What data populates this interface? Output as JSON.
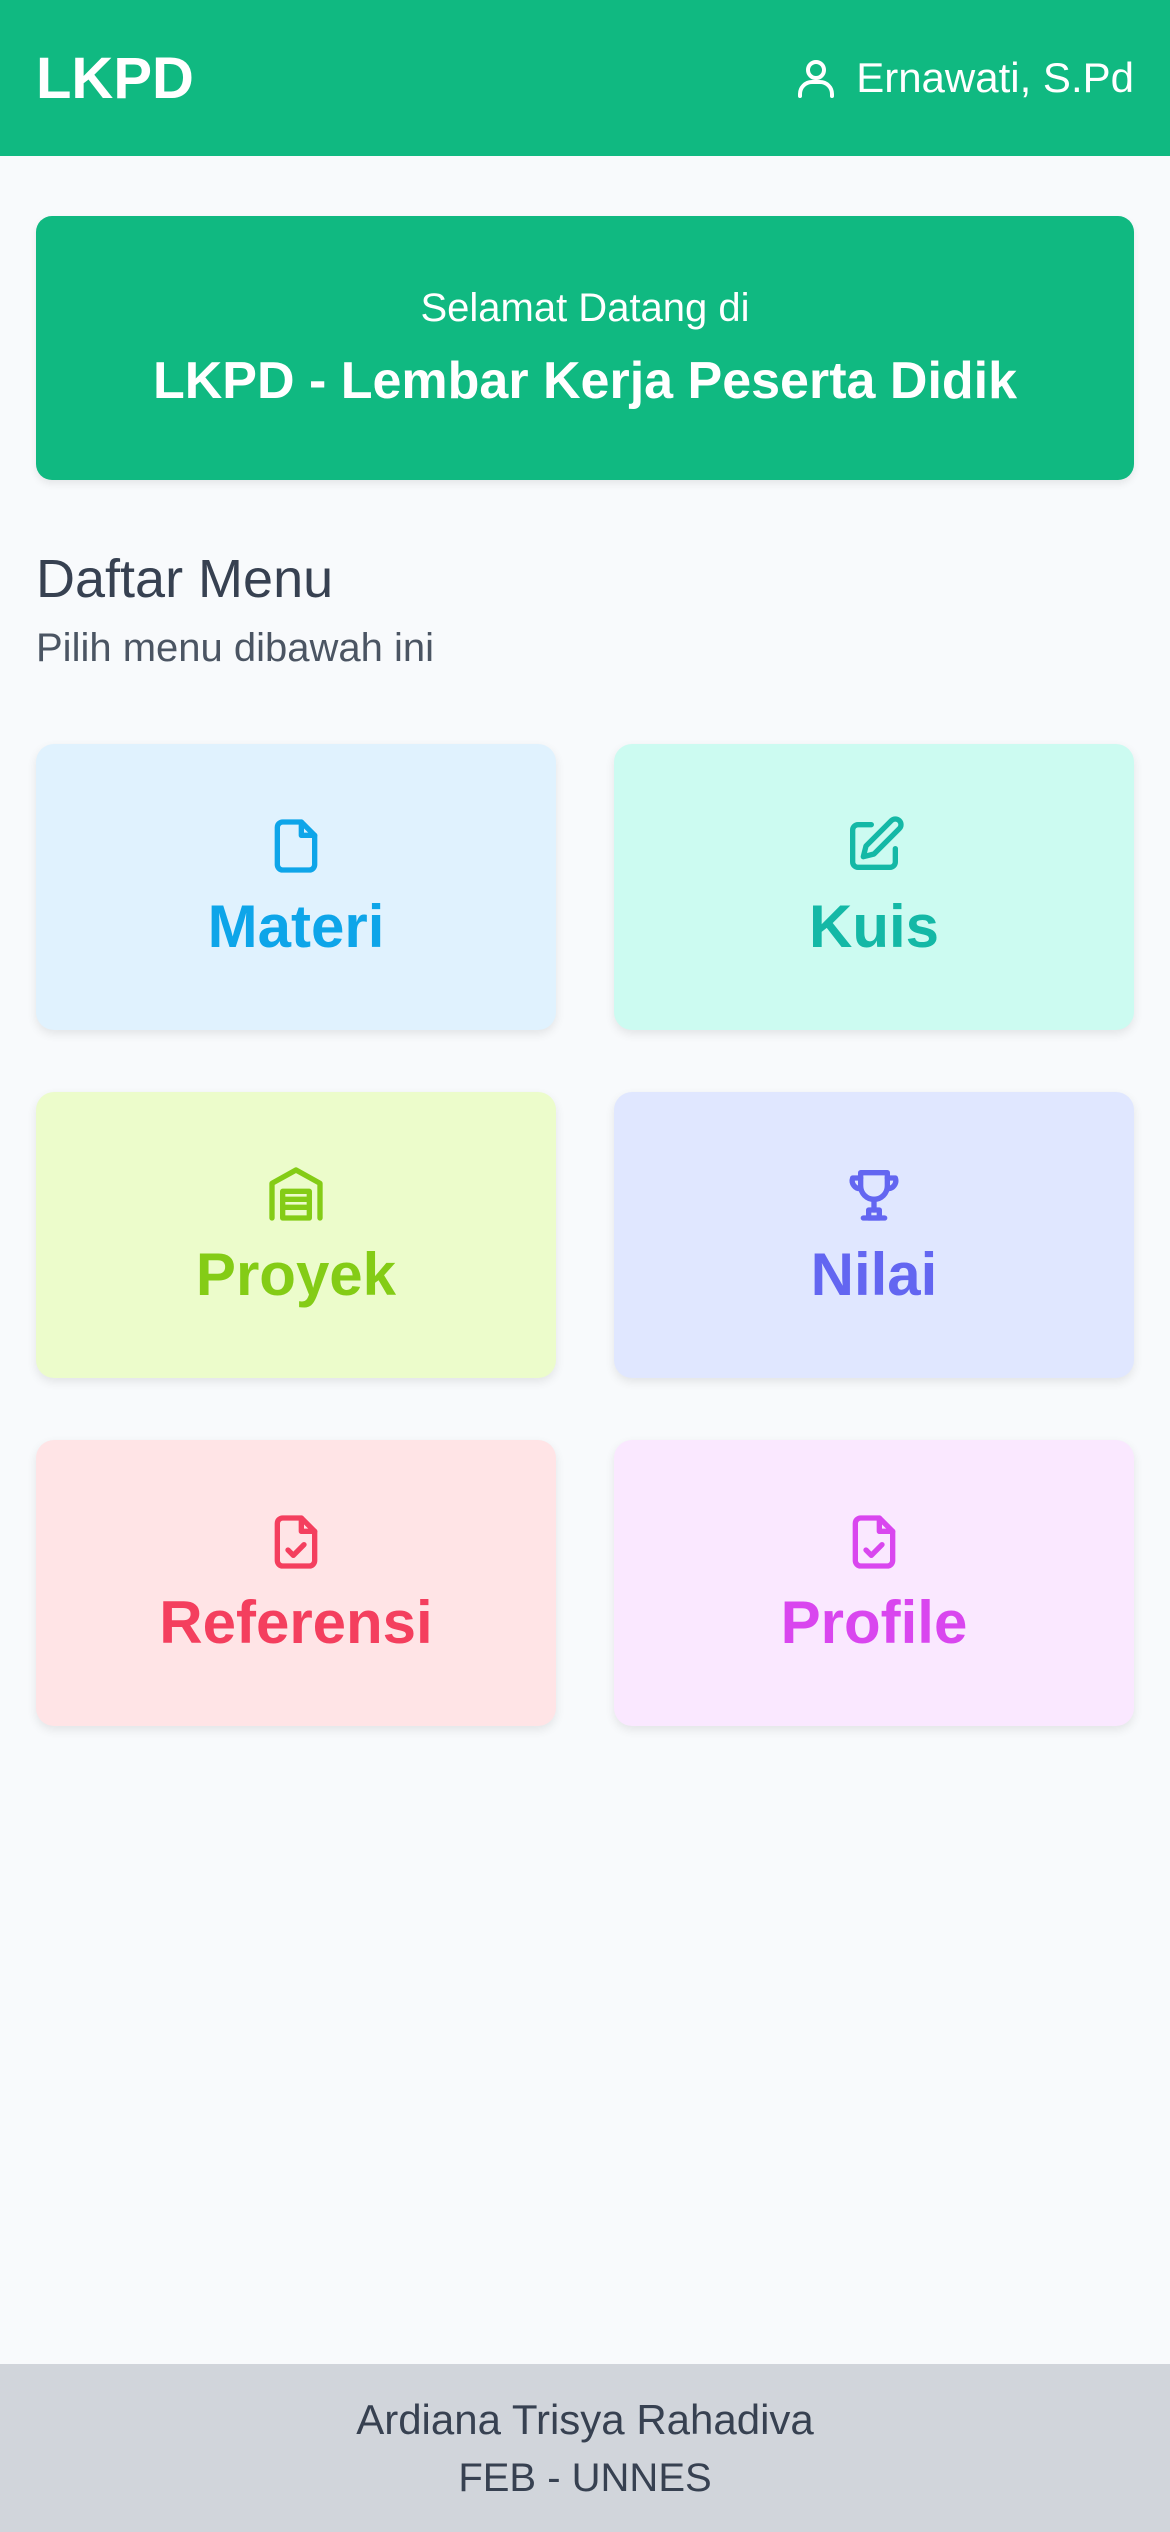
{
  "header": {
    "brand": "LKPD",
    "user_name": "Ernawati, S.Pd",
    "user_icon": "user-icon",
    "background": "#10b981"
  },
  "welcome": {
    "subtitle": "Selamat Datang di",
    "title": "LKPD - Lembar Kerja Peserta Didik"
  },
  "menu": {
    "title": "Daftar Menu",
    "subtitle": "Pilih menu dibawah ini",
    "items": [
      {
        "label": "Materi",
        "icon": "file-icon",
        "bg": "#e0f2fe",
        "color": "#0ea5e9"
      },
      {
        "label": "Kuis",
        "icon": "edit-icon",
        "bg": "#ccfbf1",
        "color": "#14b8a6"
      },
      {
        "label": "Proyek",
        "icon": "warehouse-icon",
        "bg": "#ecfccb",
        "color": "#84cc16"
      },
      {
        "label": "Nilai",
        "icon": "trophy-icon",
        "bg": "#e0e7ff",
        "color": "#6366f1"
      },
      {
        "label": "Referensi",
        "icon": "file-check-icon",
        "bg": "#ffe4e6",
        "color": "#f43f5e"
      },
      {
        "label": "Profile",
        "icon": "file-check-icon",
        "bg": "#fae8ff",
        "color": "#d946ef"
      }
    ]
  },
  "footer": {
    "name": "Ardiana Trisya Rahadiva",
    "org": "FEB - UNNES"
  }
}
